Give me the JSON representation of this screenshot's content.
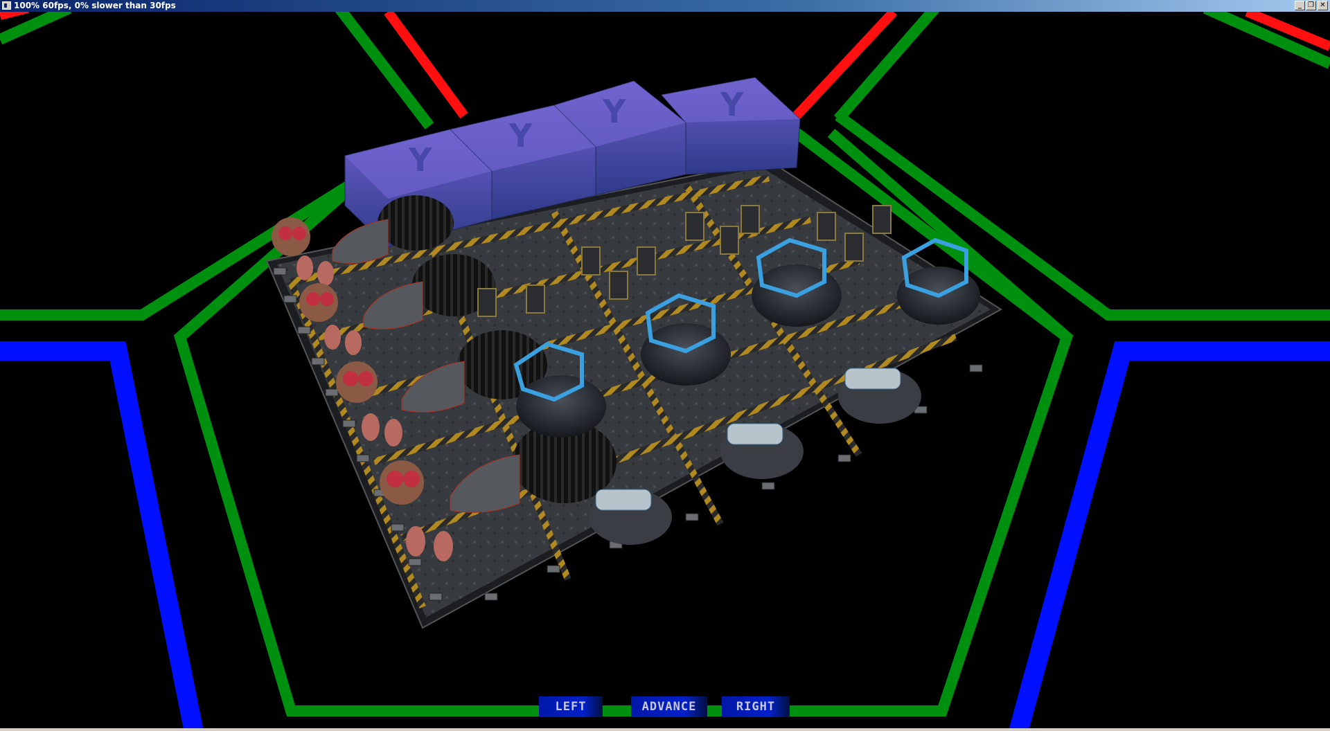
{
  "window": {
    "title": "100% 60fps, 0% slower than 30fps",
    "buttons": {
      "minimize": "_",
      "restore": "❐",
      "close": "✕"
    }
  },
  "scene": {
    "description_icons": [
      "robot-assembly",
      "thruster-icon",
      "turret-icon",
      "cube-block-icon"
    ],
    "cube_glyph": "Y"
  },
  "hud": {
    "left_label": "LEFT",
    "advance_label": "ADVANCE",
    "right_label": "RIGHT"
  },
  "colors": {
    "grid_red": "#ff1010",
    "grid_green": "#009010",
    "grid_blue": "#0010ff",
    "cube": "#5a4fb0",
    "hud_button": "#0020c8"
  }
}
